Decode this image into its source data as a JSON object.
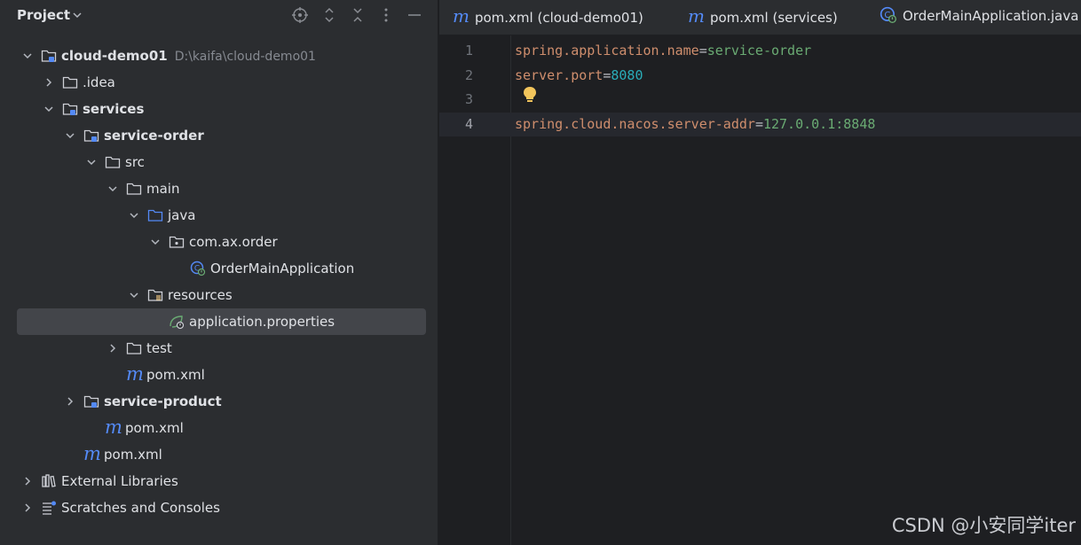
{
  "project_panel": {
    "title": "Project",
    "tree": [
      {
        "label": "cloud-demo01",
        "path": "D:\\kaifa\\cloud-demo01",
        "bold": true,
        "indent": 0,
        "chevron": "down",
        "icon": "module-folder-icon"
      },
      {
        "label": ".idea",
        "bold": false,
        "indent": 1,
        "chevron": "right",
        "icon": "folder-icon"
      },
      {
        "label": "services",
        "bold": true,
        "indent": 1,
        "chevron": "down",
        "icon": "module-folder-icon"
      },
      {
        "label": "service-order",
        "bold": true,
        "indent": 2,
        "chevron": "down",
        "icon": "module-folder-icon"
      },
      {
        "label": "src",
        "bold": false,
        "indent": 3,
        "chevron": "down",
        "icon": "folder-icon"
      },
      {
        "label": "main",
        "bold": false,
        "indent": 4,
        "chevron": "down",
        "icon": "folder-icon"
      },
      {
        "label": "java",
        "bold": false,
        "indent": 5,
        "chevron": "down",
        "icon": "source-folder-icon"
      },
      {
        "label": "com.ax.order",
        "bold": false,
        "indent": 6,
        "chevron": "down",
        "icon": "package-icon"
      },
      {
        "label": "OrderMainApplication",
        "bold": false,
        "indent": 7,
        "chevron": "none",
        "icon": "spring-boot-class-icon"
      },
      {
        "label": "resources",
        "bold": false,
        "indent": 5,
        "chevron": "down",
        "icon": "resources-folder-icon"
      },
      {
        "label": "application.properties",
        "bold": false,
        "indent": 6,
        "chevron": "none",
        "icon": "spring-properties-icon",
        "selected": true
      },
      {
        "label": "test",
        "bold": false,
        "indent": 4,
        "chevron": "right",
        "icon": "folder-icon"
      },
      {
        "label": "pom.xml",
        "bold": false,
        "indent": 4,
        "chevron": "none",
        "icon": "maven-icon"
      },
      {
        "label": "service-product",
        "bold": true,
        "indent": 2,
        "chevron": "right",
        "icon": "module-folder-icon"
      },
      {
        "label": "pom.xml",
        "bold": false,
        "indent": 3,
        "chevron": "none",
        "icon": "maven-icon"
      },
      {
        "label": "pom.xml",
        "bold": false,
        "indent": 2,
        "chevron": "none",
        "icon": "maven-icon"
      },
      {
        "label": "External Libraries",
        "bold": false,
        "indent": 0,
        "chevron": "right",
        "icon": "libraries-icon"
      },
      {
        "label": "Scratches and Consoles",
        "bold": false,
        "indent": 0,
        "chevron": "right",
        "icon": "scratches-icon"
      }
    ]
  },
  "tabs": [
    {
      "label": "pom.xml (cloud-demo01)",
      "icon": "maven-icon"
    },
    {
      "label": "pom.xml (services)",
      "icon": "maven-icon"
    },
    {
      "label": "OrderMainApplication.java",
      "icon": "spring-boot-class-icon"
    }
  ],
  "editor": {
    "lines": [
      {
        "num": "1",
        "key": "spring.application.name",
        "eq": "=",
        "value": "service-order",
        "value_type": "string"
      },
      {
        "num": "2",
        "key": "server.port",
        "eq": "=",
        "value": "8080",
        "value_type": "number"
      },
      {
        "num": "3",
        "key": "",
        "eq": "",
        "value": "",
        "value_type": "string"
      },
      {
        "num": "4",
        "key": "spring.cloud.nacos.server-addr",
        "eq": "=",
        "value": "127.0.0.1:8848",
        "value_type": "string",
        "current": true
      }
    ]
  },
  "watermark": "CSDN @小安同学iter",
  "colors": {
    "panel_bg": "#2b2d30",
    "editor_bg": "#1e1f22",
    "selection": "#43454a",
    "maven_blue": "#548af7",
    "key_orange": "#cf8e6d",
    "string_green": "#6aab73",
    "number_cyan": "#2aacb8"
  }
}
